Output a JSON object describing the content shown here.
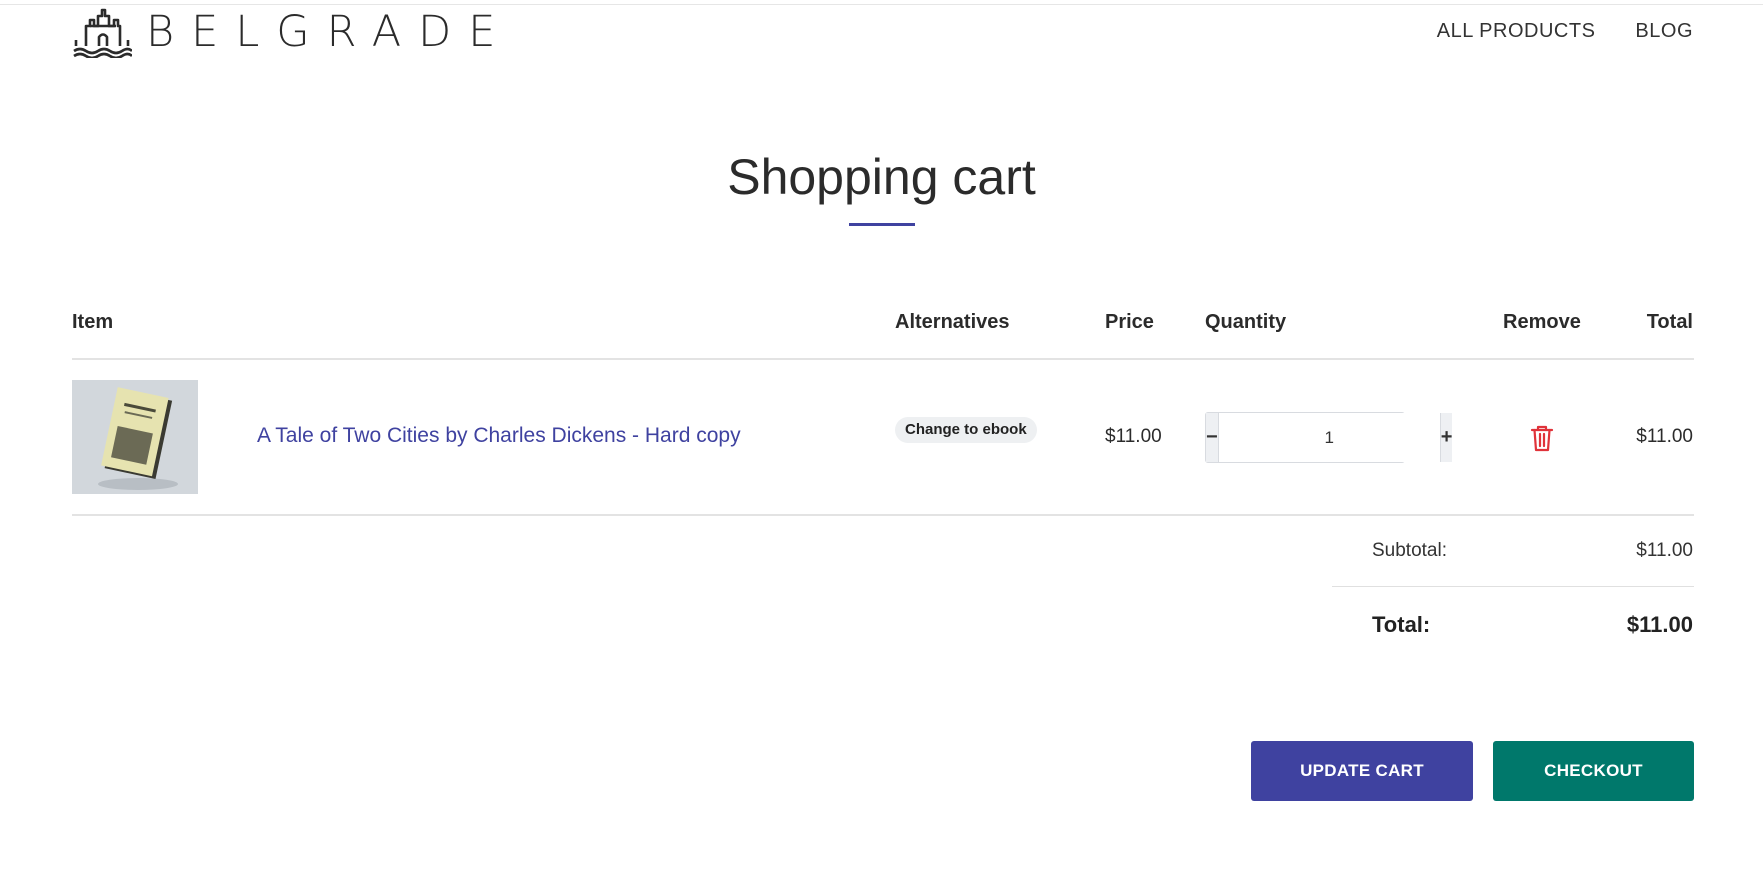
{
  "brand": {
    "name": "BELGRADE",
    "logo_icon": "castle-icon"
  },
  "nav": {
    "items": [
      {
        "label": "ALL PRODUCTS"
      },
      {
        "label": "BLOG"
      }
    ]
  },
  "page": {
    "title": "Shopping cart",
    "accent_color": "#3f42a0"
  },
  "table": {
    "headers": {
      "item": "Item",
      "alternatives": "Alternatives",
      "price": "Price",
      "quantity": "Quantity",
      "remove": "Remove",
      "total": "Total"
    },
    "rows": [
      {
        "name": "A Tale of Two Cities by Charles Dickens - Hard copy",
        "alternative": "Change to ebook",
        "price": "$11.00",
        "quantity": "1",
        "minus_label": "−",
        "plus_label": "+",
        "remove_icon": "trash-icon",
        "total": "$11.00"
      }
    ]
  },
  "totals": {
    "subtotal_label": "Subtotal:",
    "subtotal_value": "$11.00",
    "total_label": "Total:",
    "total_value": "$11.00"
  },
  "actions": {
    "update_label": "UPDATE CART",
    "checkout_label": "CHECKOUT",
    "update_color": "#3f42a0",
    "checkout_color": "#00786b"
  }
}
